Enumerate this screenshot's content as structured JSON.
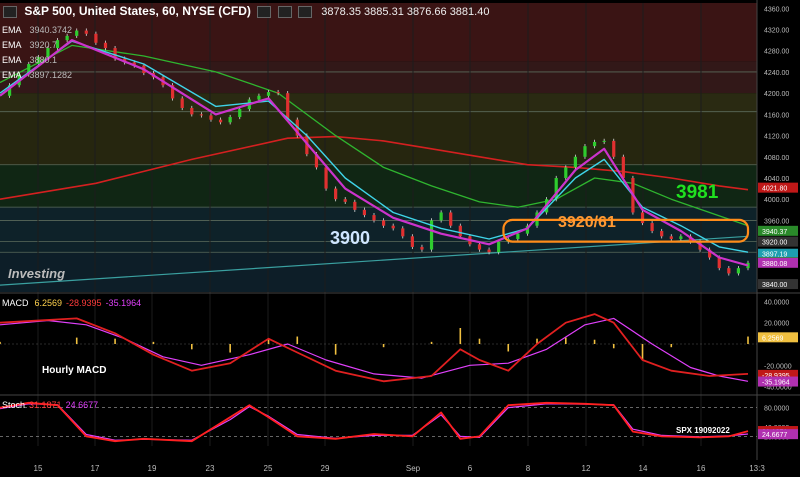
{
  "header": {
    "symbol": "S&P 500, United States, 60, NYSE (CFD)",
    "ohlc": "3878.35  3885.31  3876.66  3881.40"
  },
  "ema_legend": [
    {
      "label": "EMA",
      "value": "3940.3742"
    },
    {
      "label": "EMA",
      "value": "3920.7"
    },
    {
      "label": "EMA",
      "value": "3880.1"
    },
    {
      "label": "EMA",
      "value": "3897.1282"
    }
  ],
  "watermark": "Investing",
  "annotations": {
    "level_3981": "3981",
    "zone_label": "3920/61",
    "level_3900": "3900"
  },
  "macd": {
    "title": "MACD",
    "v1": "6.2569",
    "v2": "-28.9395",
    "v3": "-35.1964",
    "note": "Hourly MACD"
  },
  "stoch": {
    "title": "Stoch",
    "v1": "31.1871",
    "v2": "24.6677"
  },
  "footer_note": "SPX 19092022",
  "colors": {
    "price_line_red": "#d42020",
    "ema_fast_magenta": "#cc33cc",
    "ema_cyan": "#3fd4e8",
    "ema_green": "#2fb52f",
    "trend_line": "#3aa0a0",
    "zone_orange": "#ff8c1a",
    "label_green": "#20e020",
    "label_white_blue": "#cfe6ff"
  },
  "chart_data": {
    "type": "line",
    "price_axis": {
      "ticks": [
        4360,
        4320,
        4280,
        4240,
        4200,
        4160,
        4120,
        4080,
        4040,
        4000,
        3960,
        3920,
        3880,
        3840
      ],
      "ylim": [
        3825,
        4370
      ],
      "marked_values": [
        "4021.80",
        "3940.37",
        "3920.00",
        "3897.19",
        "3881.40",
        "3880.08",
        "3840.00"
      ]
    },
    "x_ticks": [
      "15",
      "17",
      "19",
      "23",
      "25",
      "29",
      "Sep",
      "6",
      "8",
      "12",
      "14",
      "16",
      "13:3"
    ],
    "price_series": [
      [
        0,
        4195
      ],
      [
        2,
        4215
      ],
      [
        4,
        4235
      ],
      [
        6,
        4255
      ],
      [
        8,
        4268
      ],
      [
        10,
        4285
      ],
      [
        12,
        4300
      ],
      [
        14,
        4308
      ],
      [
        16,
        4318
      ],
      [
        18,
        4312
      ],
      [
        20,
        4295
      ],
      [
        22,
        4285
      ],
      [
        24,
        4265
      ],
      [
        26,
        4258
      ],
      [
        28,
        4252
      ],
      [
        30,
        4238
      ],
      [
        32,
        4230
      ],
      [
        34,
        4215
      ],
      [
        36,
        4190
      ],
      [
        38,
        4172
      ],
      [
        40,
        4160
      ],
      [
        42,
        4158
      ],
      [
        44,
        4150
      ],
      [
        46,
        4145
      ],
      [
        48,
        4155
      ],
      [
        50,
        4170
      ],
      [
        52,
        4188
      ],
      [
        54,
        4195
      ],
      [
        56,
        4202
      ],
      [
        58,
        4200
      ],
      [
        60,
        4150
      ],
      [
        62,
        4120
      ],
      [
        64,
        4085
      ],
      [
        66,
        4060
      ],
      [
        68,
        4020
      ],
      [
        70,
        4000
      ],
      [
        72,
        3995
      ],
      [
        74,
        3980
      ],
      [
        76,
        3970
      ],
      [
        78,
        3960
      ],
      [
        80,
        3950
      ],
      [
        82,
        3945
      ],
      [
        84,
        3930
      ],
      [
        86,
        3910
      ],
      [
        88,
        3905
      ],
      [
        90,
        3960
      ],
      [
        92,
        3975
      ],
      [
        94,
        3950
      ],
      [
        96,
        3930
      ],
      [
        98,
        3915
      ],
      [
        100,
        3905
      ],
      [
        102,
        3900
      ],
      [
        104,
        3920
      ],
      [
        106,
        3925
      ],
      [
        108,
        3935
      ],
      [
        110,
        3950
      ],
      [
        112,
        3975
      ],
      [
        114,
        4000
      ],
      [
        116,
        4040
      ],
      [
        118,
        4060
      ],
      [
        120,
        4080
      ],
      [
        122,
        4100
      ],
      [
        124,
        4108
      ],
      [
        126,
        4110
      ],
      [
        128,
        4080
      ],
      [
        130,
        4040
      ],
      [
        132,
        3975
      ],
      [
        134,
        3955
      ],
      [
        136,
        3940
      ],
      [
        138,
        3930
      ],
      [
        140,
        3925
      ],
      [
        142,
        3930
      ],
      [
        144,
        3920
      ],
      [
        146,
        3905
      ],
      [
        148,
        3890
      ],
      [
        150,
        3870
      ],
      [
        152,
        3860
      ],
      [
        154,
        3870
      ],
      [
        156,
        3880
      ]
    ],
    "ema_red": [
      [
        0,
        4000
      ],
      [
        20,
        4030
      ],
      [
        40,
        4075
      ],
      [
        60,
        4115
      ],
      [
        70,
        4118
      ],
      [
        80,
        4110
      ],
      [
        90,
        4095
      ],
      [
        100,
        4080
      ],
      [
        110,
        4065
      ],
      [
        120,
        4060
      ],
      [
        130,
        4052
      ],
      [
        140,
        4040
      ],
      [
        150,
        4025
      ],
      [
        156,
        4018
      ]
    ],
    "ema_green": [
      [
        0,
        4220
      ],
      [
        15,
        4290
      ],
      [
        30,
        4270
      ],
      [
        45,
        4240
      ],
      [
        58,
        4200
      ],
      [
        70,
        4120
      ],
      [
        80,
        4060
      ],
      [
        90,
        4025
      ],
      [
        100,
        3995
      ],
      [
        108,
        3985
      ],
      [
        116,
        4000
      ],
      [
        124,
        4040
      ],
      [
        132,
        4030
      ],
      [
        140,
        4000
      ],
      [
        148,
        3975
      ],
      [
        156,
        3950
      ]
    ],
    "ema_cyan": [
      [
        0,
        4200
      ],
      [
        15,
        4298
      ],
      [
        30,
        4255
      ],
      [
        45,
        4175
      ],
      [
        56,
        4185
      ],
      [
        64,
        4120
      ],
      [
        72,
        4040
      ],
      [
        82,
        3975
      ],
      [
        92,
        3945
      ],
      [
        102,
        3925
      ],
      [
        110,
        3945
      ],
      [
        120,
        4040
      ],
      [
        126,
        4075
      ],
      [
        134,
        3985
      ],
      [
        142,
        3950
      ],
      [
        150,
        3910
      ],
      [
        156,
        3900
      ]
    ],
    "ema_magenta": [
      [
        0,
        4195
      ],
      [
        15,
        4300
      ],
      [
        30,
        4245
      ],
      [
        45,
        4160
      ],
      [
        56,
        4190
      ],
      [
        64,
        4105
      ],
      [
        72,
        4020
      ],
      [
        82,
        3965
      ],
      [
        92,
        3935
      ],
      [
        102,
        3915
      ],
      [
        110,
        3945
      ],
      [
        120,
        4055
      ],
      [
        126,
        4095
      ],
      [
        134,
        3980
      ],
      [
        142,
        3940
      ],
      [
        150,
        3890
      ],
      [
        156,
        3875
      ]
    ],
    "trend_line": [
      [
        0,
        3838
      ],
      [
        156,
        3930
      ]
    ],
    "zone": {
      "low": 3920,
      "high": 3961,
      "x_start": 105,
      "x_end": 156
    },
    "bands": [
      {
        "from": 4260,
        "to": 4370,
        "color": "#3a1414"
      },
      {
        "from": 4200,
        "to": 4260,
        "color": "#321818"
      },
      {
        "from": 4165,
        "to": 4200,
        "color": "#2a2a12"
      },
      {
        "from": 4065,
        "to": 4165,
        "color": "#26260f"
      },
      {
        "from": 3985,
        "to": 4065,
        "color": "#102614"
      },
      {
        "from": 3900,
        "to": 3985,
        "color": "#0e2229"
      },
      {
        "from": 3825,
        "to": 3900,
        "color": "#0d1e28"
      }
    ],
    "macd_axis": {
      "ticks": [
        "40.0000",
        "20.0000",
        "-20.0000",
        "-40.0000"
      ],
      "values": [
        40,
        20,
        -20,
        -40
      ],
      "ylim": [
        -45,
        45
      ]
    },
    "macd_line": [
      [
        0,
        20
      ],
      [
        8,
        22
      ],
      [
        16,
        24
      ],
      [
        24,
        10
      ],
      [
        32,
        -10
      ],
      [
        40,
        -25
      ],
      [
        48,
        -18
      ],
      [
        56,
        5
      ],
      [
        62,
        -8
      ],
      [
        70,
        -25
      ],
      [
        80,
        -35
      ],
      [
        90,
        -30
      ],
      [
        96,
        -5
      ],
      [
        100,
        -15
      ],
      [
        106,
        -25
      ],
      [
        112,
        0
      ],
      [
        118,
        20
      ],
      [
        124,
        28
      ],
      [
        128,
        20
      ],
      [
        134,
        -15
      ],
      [
        140,
        -25
      ],
      [
        148,
        -30
      ],
      [
        156,
        -28
      ]
    ],
    "macd_signal": [
      [
        0,
        18
      ],
      [
        10,
        22
      ],
      [
        18,
        18
      ],
      [
        26,
        5
      ],
      [
        34,
        -12
      ],
      [
        42,
        -20
      ],
      [
        52,
        -10
      ],
      [
        60,
        0
      ],
      [
        68,
        -15
      ],
      [
        78,
        -28
      ],
      [
        88,
        -32
      ],
      [
        98,
        -20
      ],
      [
        106,
        -18
      ],
      [
        114,
        -5
      ],
      [
        122,
        18
      ],
      [
        128,
        24
      ],
      [
        136,
        0
      ],
      [
        144,
        -22
      ],
      [
        150,
        -30
      ],
      [
        156,
        -35
      ]
    ],
    "macd_hist": [
      [
        0,
        2
      ],
      [
        8,
        0
      ],
      [
        16,
        6
      ],
      [
        24,
        5
      ],
      [
        32,
        2
      ],
      [
        40,
        -5
      ],
      [
        48,
        -8
      ],
      [
        56,
        5
      ],
      [
        62,
        7
      ],
      [
        70,
        -10
      ],
      [
        80,
        -3
      ],
      [
        90,
        2
      ],
      [
        96,
        15
      ],
      [
        100,
        5
      ],
      [
        106,
        -7
      ],
      [
        112,
        5
      ],
      [
        118,
        6
      ],
      [
        124,
        4
      ],
      [
        128,
        -4
      ],
      [
        134,
        -15
      ],
      [
        140,
        -3
      ],
      [
        148,
        0
      ],
      [
        156,
        7
      ]
    ],
    "stoch_axis": {
      "ticks": [
        "80.0000",
        "40.0000",
        "20.0000"
      ],
      "values": [
        80,
        40,
        20
      ],
      "ylim": [
        0,
        100
      ]
    },
    "stoch_k": [
      [
        0,
        80
      ],
      [
        6,
        90
      ],
      [
        12,
        85
      ],
      [
        18,
        20
      ],
      [
        24,
        10
      ],
      [
        30,
        15
      ],
      [
        40,
        10
      ],
      [
        48,
        60
      ],
      [
        52,
        85
      ],
      [
        56,
        60
      ],
      [
        62,
        20
      ],
      [
        70,
        15
      ],
      [
        78,
        25
      ],
      [
        86,
        20
      ],
      [
        92,
        70
      ],
      [
        96,
        15
      ],
      [
        100,
        20
      ],
      [
        106,
        85
      ],
      [
        114,
        90
      ],
      [
        122,
        88
      ],
      [
        128,
        85
      ],
      [
        132,
        30
      ],
      [
        138,
        20
      ],
      [
        146,
        18
      ],
      [
        152,
        20
      ],
      [
        156,
        31
      ]
    ],
    "stoch_d": [
      [
        0,
        78
      ],
      [
        6,
        88
      ],
      [
        12,
        86
      ],
      [
        18,
        24
      ],
      [
        24,
        12
      ],
      [
        30,
        14
      ],
      [
        40,
        12
      ],
      [
        48,
        55
      ],
      [
        52,
        82
      ],
      [
        56,
        62
      ],
      [
        62,
        24
      ],
      [
        70,
        16
      ],
      [
        78,
        22
      ],
      [
        86,
        22
      ],
      [
        92,
        65
      ],
      [
        96,
        20
      ],
      [
        100,
        18
      ],
      [
        106,
        80
      ],
      [
        114,
        88
      ],
      [
        122,
        87
      ],
      [
        128,
        86
      ],
      [
        132,
        35
      ],
      [
        138,
        22
      ],
      [
        146,
        19
      ],
      [
        152,
        21
      ],
      [
        156,
        25
      ]
    ]
  }
}
